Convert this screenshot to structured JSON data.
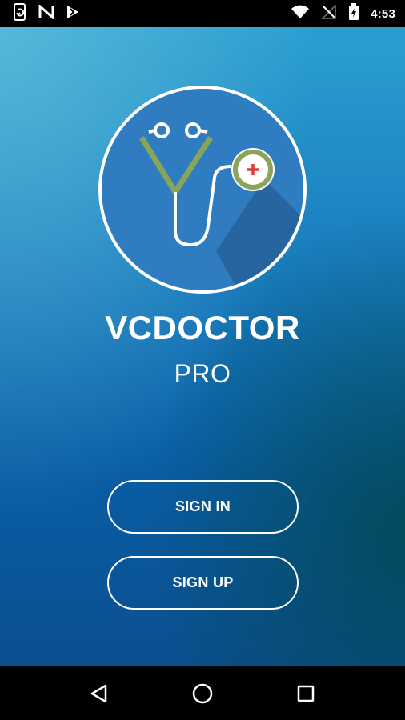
{
  "status_bar": {
    "time": "4:53",
    "left_icons": [
      "phone-sync-icon",
      "n-app-icon",
      "download-flag-icon"
    ],
    "right_icons": [
      "wifi-icon",
      "no-signal-icon",
      "battery-charging-icon"
    ]
  },
  "app": {
    "title": "VCDOCTOR",
    "subtitle": "PRO",
    "logo_icon": "stethoscope-icon",
    "colors": {
      "background_top": "#2b9fd0",
      "background_bottom": "#0a4f8f",
      "logo_circle": "#2f7cc0",
      "stethoscope_green": "#8aa55a",
      "cross_red": "#e23a3a"
    }
  },
  "buttons": {
    "sign_in": "SIGN IN",
    "sign_up": "SIGN UP"
  },
  "nav_bar": {
    "icons": [
      "back-triangle-icon",
      "home-circle-icon",
      "recents-square-icon"
    ]
  }
}
